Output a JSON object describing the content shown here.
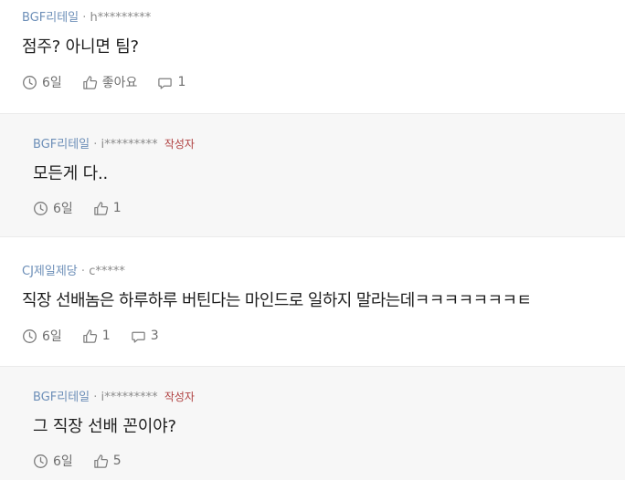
{
  "comments": [
    {
      "company": "BGF리테일",
      "separator": "·",
      "user": "h*********",
      "author_tag": "",
      "text": "점주? 아니면 팀?",
      "time": "6일",
      "like_label": "좋아요",
      "reply_count": "1"
    },
    {
      "company": "BGF리테일",
      "separator": "·",
      "user": "i*********",
      "author_tag": "작성자",
      "text": "모든게 다..",
      "time": "6일",
      "like_label": "1"
    },
    {
      "company": "CJ제일제당",
      "separator": "·",
      "user": "c*****",
      "author_tag": "",
      "text": "직장 선배놈은 하루하루 버틴다는 마인드로 일하지 말라는데ㅋㅋㅋㅋㅋㅋㅋㅌ",
      "time": "6일",
      "like_label": "1",
      "reply_count": "3"
    },
    {
      "company": "BGF리테일",
      "separator": "·",
      "user": "i*********",
      "author_tag": "작성자",
      "text": "그 직장 선배 꼰이야?",
      "time": "6일",
      "like_label": "5"
    }
  ],
  "icons": {
    "time": "clock-icon",
    "like": "thumbs-up-icon",
    "reply": "comment-bubble-icon"
  },
  "colors": {
    "company": "#6d8fb8",
    "author_tag": "#b04141",
    "reply_background": "#f7f7f7",
    "divider": "#ebebeb"
  }
}
